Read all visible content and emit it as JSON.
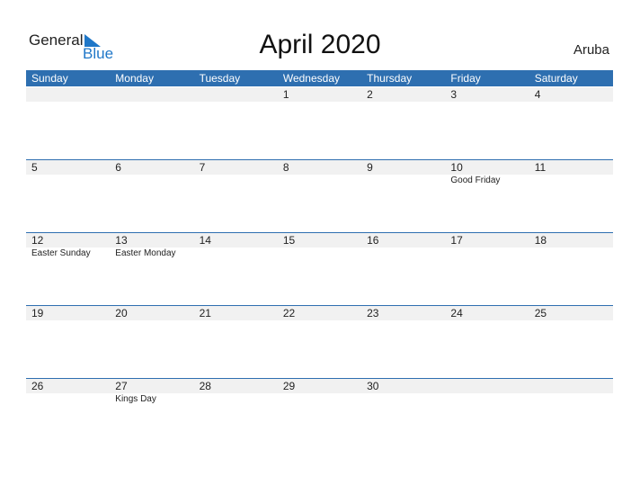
{
  "logo": {
    "general": "General",
    "blue": "Blue"
  },
  "title": "April 2020",
  "country": "Aruba",
  "days": [
    "Sunday",
    "Monday",
    "Tuesday",
    "Wednesday",
    "Thursday",
    "Friday",
    "Saturday"
  ],
  "weeks": [
    {
      "dates": [
        "",
        "",
        "",
        "1",
        "2",
        "3",
        "4"
      ],
      "events": [
        "",
        "",
        "",
        "",
        "",
        "",
        ""
      ]
    },
    {
      "dates": [
        "5",
        "6",
        "7",
        "8",
        "9",
        "10",
        "11"
      ],
      "events": [
        "",
        "",
        "",
        "",
        "",
        "Good Friday",
        ""
      ]
    },
    {
      "dates": [
        "12",
        "13",
        "14",
        "15",
        "16",
        "17",
        "18"
      ],
      "events": [
        "Easter Sunday",
        "Easter Monday",
        "",
        "",
        "",
        "",
        ""
      ]
    },
    {
      "dates": [
        "19",
        "20",
        "21",
        "22",
        "23",
        "24",
        "25"
      ],
      "events": [
        "",
        "",
        "",
        "",
        "",
        "",
        ""
      ]
    },
    {
      "dates": [
        "26",
        "27",
        "28",
        "29",
        "30",
        "",
        ""
      ],
      "events": [
        "",
        "Kings Day",
        "",
        "",
        "",
        "",
        ""
      ]
    }
  ]
}
